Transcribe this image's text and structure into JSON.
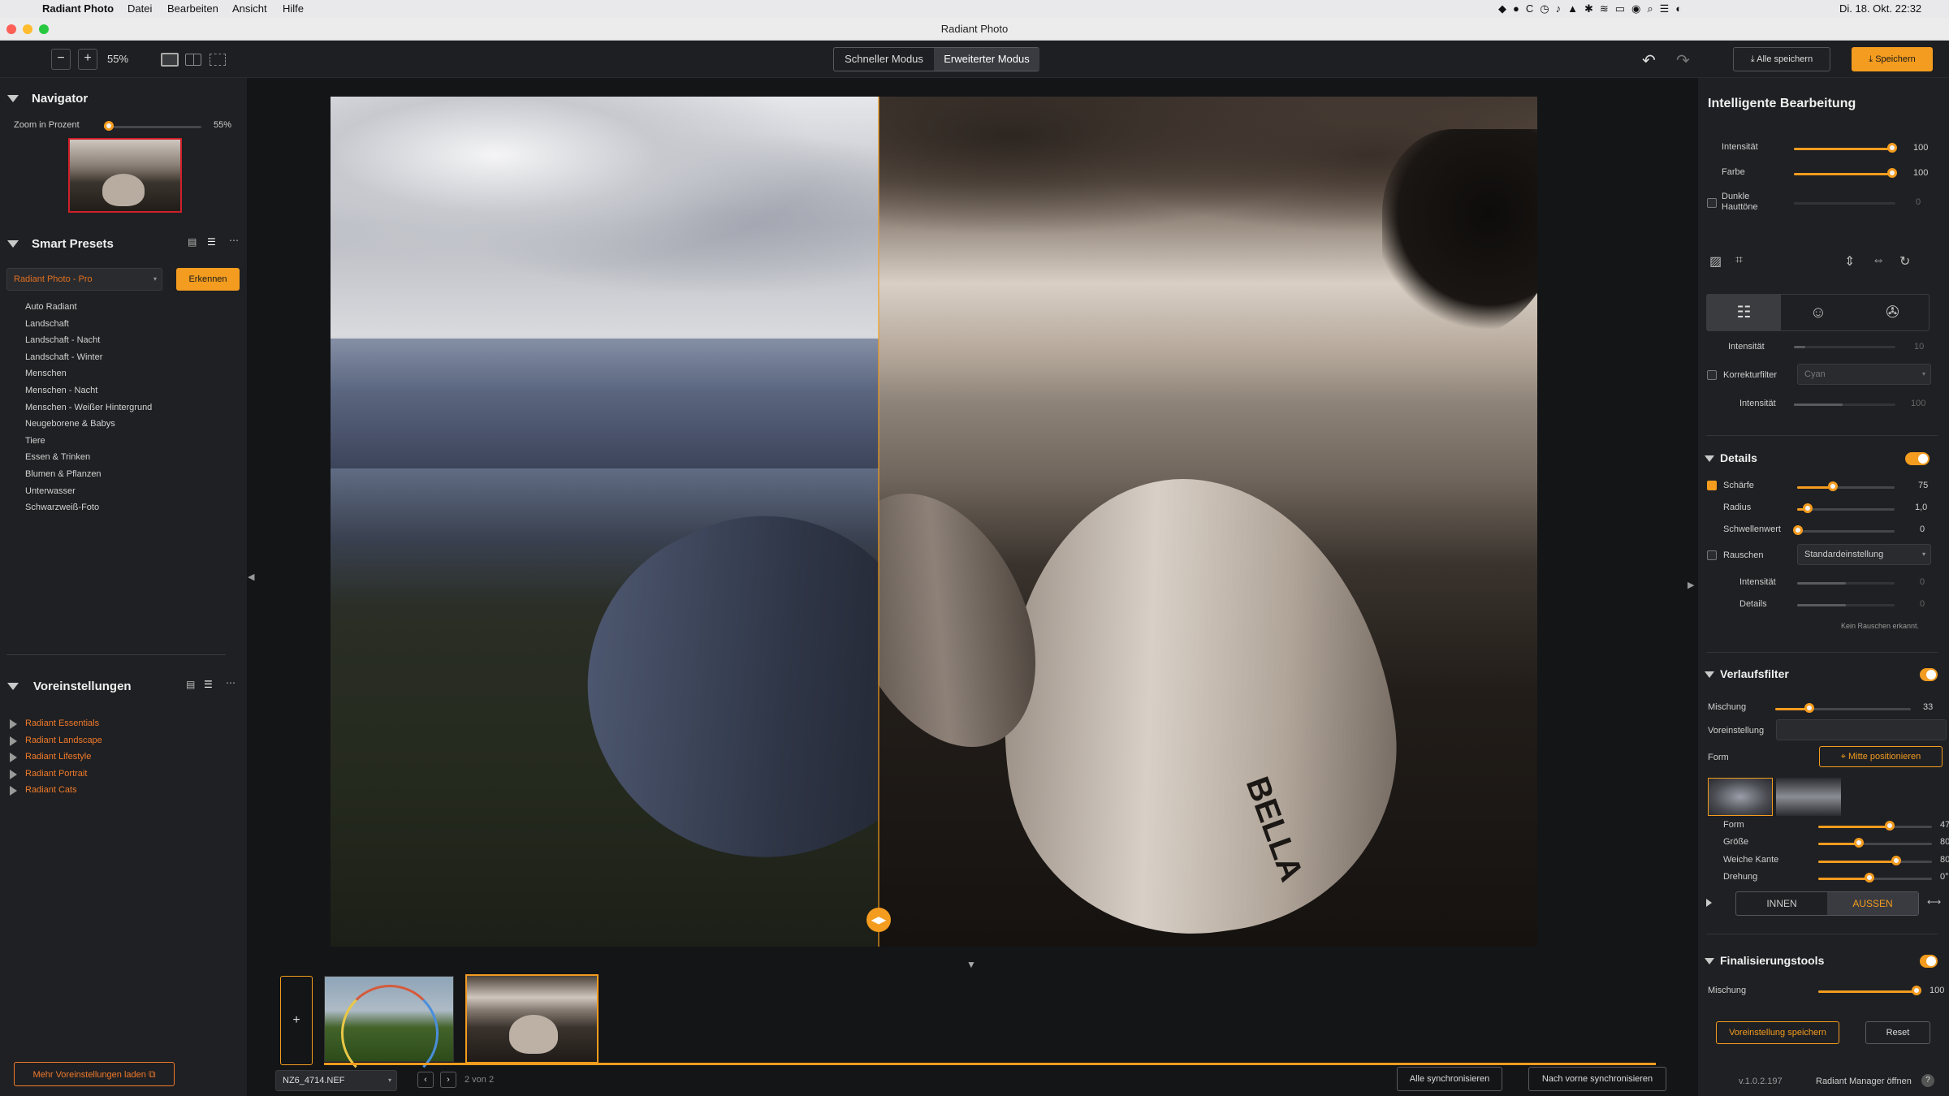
{
  "menubar": {
    "app": "Radiant Photo",
    "items": [
      "Datei",
      "Bearbeiten",
      "Ansicht",
      "Hilfe"
    ],
    "clock": "Di. 18. Okt. 22:32"
  },
  "window": {
    "title": "Radiant Photo"
  },
  "toolbar": {
    "zoom": "55%",
    "mode_quick": "Schneller Modus",
    "mode_advanced": "Erweiterter Modus",
    "save_all": "Alle speichern",
    "save": "Speichern"
  },
  "navigator": {
    "title": "Navigator",
    "zoom_label": "Zoom in Prozent",
    "zoom_value": "55%",
    "zoom_fraction": 0.55
  },
  "smart_presets": {
    "title": "Smart Presets",
    "dropdown": "Radiant Photo - Pro",
    "detect": "Erkennen",
    "items": [
      "Auto Radiant",
      "Landschaft",
      "Landschaft - Nacht",
      "Landschaft - Winter",
      "Menschen",
      "Menschen - Nacht",
      "Menschen - Weißer Hintergrund",
      "Neugeborene & Babys",
      "Tiere",
      "Essen & Trinken",
      "Blumen & Pflanzen",
      "Unterwasser",
      "Schwarzweiß-Foto"
    ]
  },
  "presets": {
    "title": "Voreinstellungen",
    "items": [
      "Radiant Essentials",
      "Radiant Landscape",
      "Radiant Lifestyle",
      "Radiant Portrait",
      "Radiant Cats"
    ],
    "load_more": "Mehr Voreinstellungen laden"
  },
  "bottom": {
    "filename": "NZ6_4714.NEF",
    "page": "2 von 2",
    "sync_all": "Alle synchronisieren",
    "sync_forward": "Nach vorne synchronisieren",
    "add": "+"
  },
  "right": {
    "title": "Intelligente Bearbeitung",
    "intensity_label": "Intensität",
    "intensity": "100",
    "color_label": "Farbe",
    "color": "100",
    "dark_skin_label1": "Dunkle",
    "dark_skin_label2": "Hauttöne",
    "dark_skin": "0",
    "tab_intensity_label": "Intensität",
    "tab_intensity": "10",
    "correction_filter_label": "Korrekturfilter",
    "correction_filter": "Cyan",
    "cf_intensity_label": "Intensität",
    "cf_intensity": "100",
    "details": {
      "title": "Details",
      "sharpness_label": "Schärfe",
      "sharpness": "75",
      "radius_label": "Radius",
      "radius": "1,0",
      "threshold_label": "Schwellenwert",
      "threshold": "0",
      "noise_label": "Rauschen",
      "noise_dropdown": "Standardeinstellung",
      "n_intensity_label": "Intensität",
      "n_intensity": "0",
      "n_details_label": "Details",
      "n_details": "0",
      "noise_note": "Kein Rauschen erkannt."
    },
    "gradient": {
      "title": "Verlaufsfilter",
      "mix_label": "Mischung",
      "mix": "33",
      "preset_label": "Voreinstellung",
      "form_label": "Form",
      "center_btn": "Mitte positionieren",
      "shape_label": "Form",
      "shape": "47",
      "size_label": "Größe",
      "size": "80",
      "soft_label": "Weiche Kante",
      "soft": "80",
      "rotate_label": "Drehung",
      "rotate": "0°",
      "inside": "INNEN",
      "outside": "AUSSEN"
    },
    "finishing": {
      "title": "Finalisierungstools",
      "mix_label": "Mischung",
      "mix": "100"
    },
    "save_preset": "Voreinstellung speichern",
    "reset": "Reset",
    "version": "v.1.0.2.197",
    "manager": "Radiant Manager öffnen"
  },
  "colors": {
    "accent": "#f39c1f",
    "preset_orange": "#f07a2a",
    "bg": "#1f2023"
  }
}
